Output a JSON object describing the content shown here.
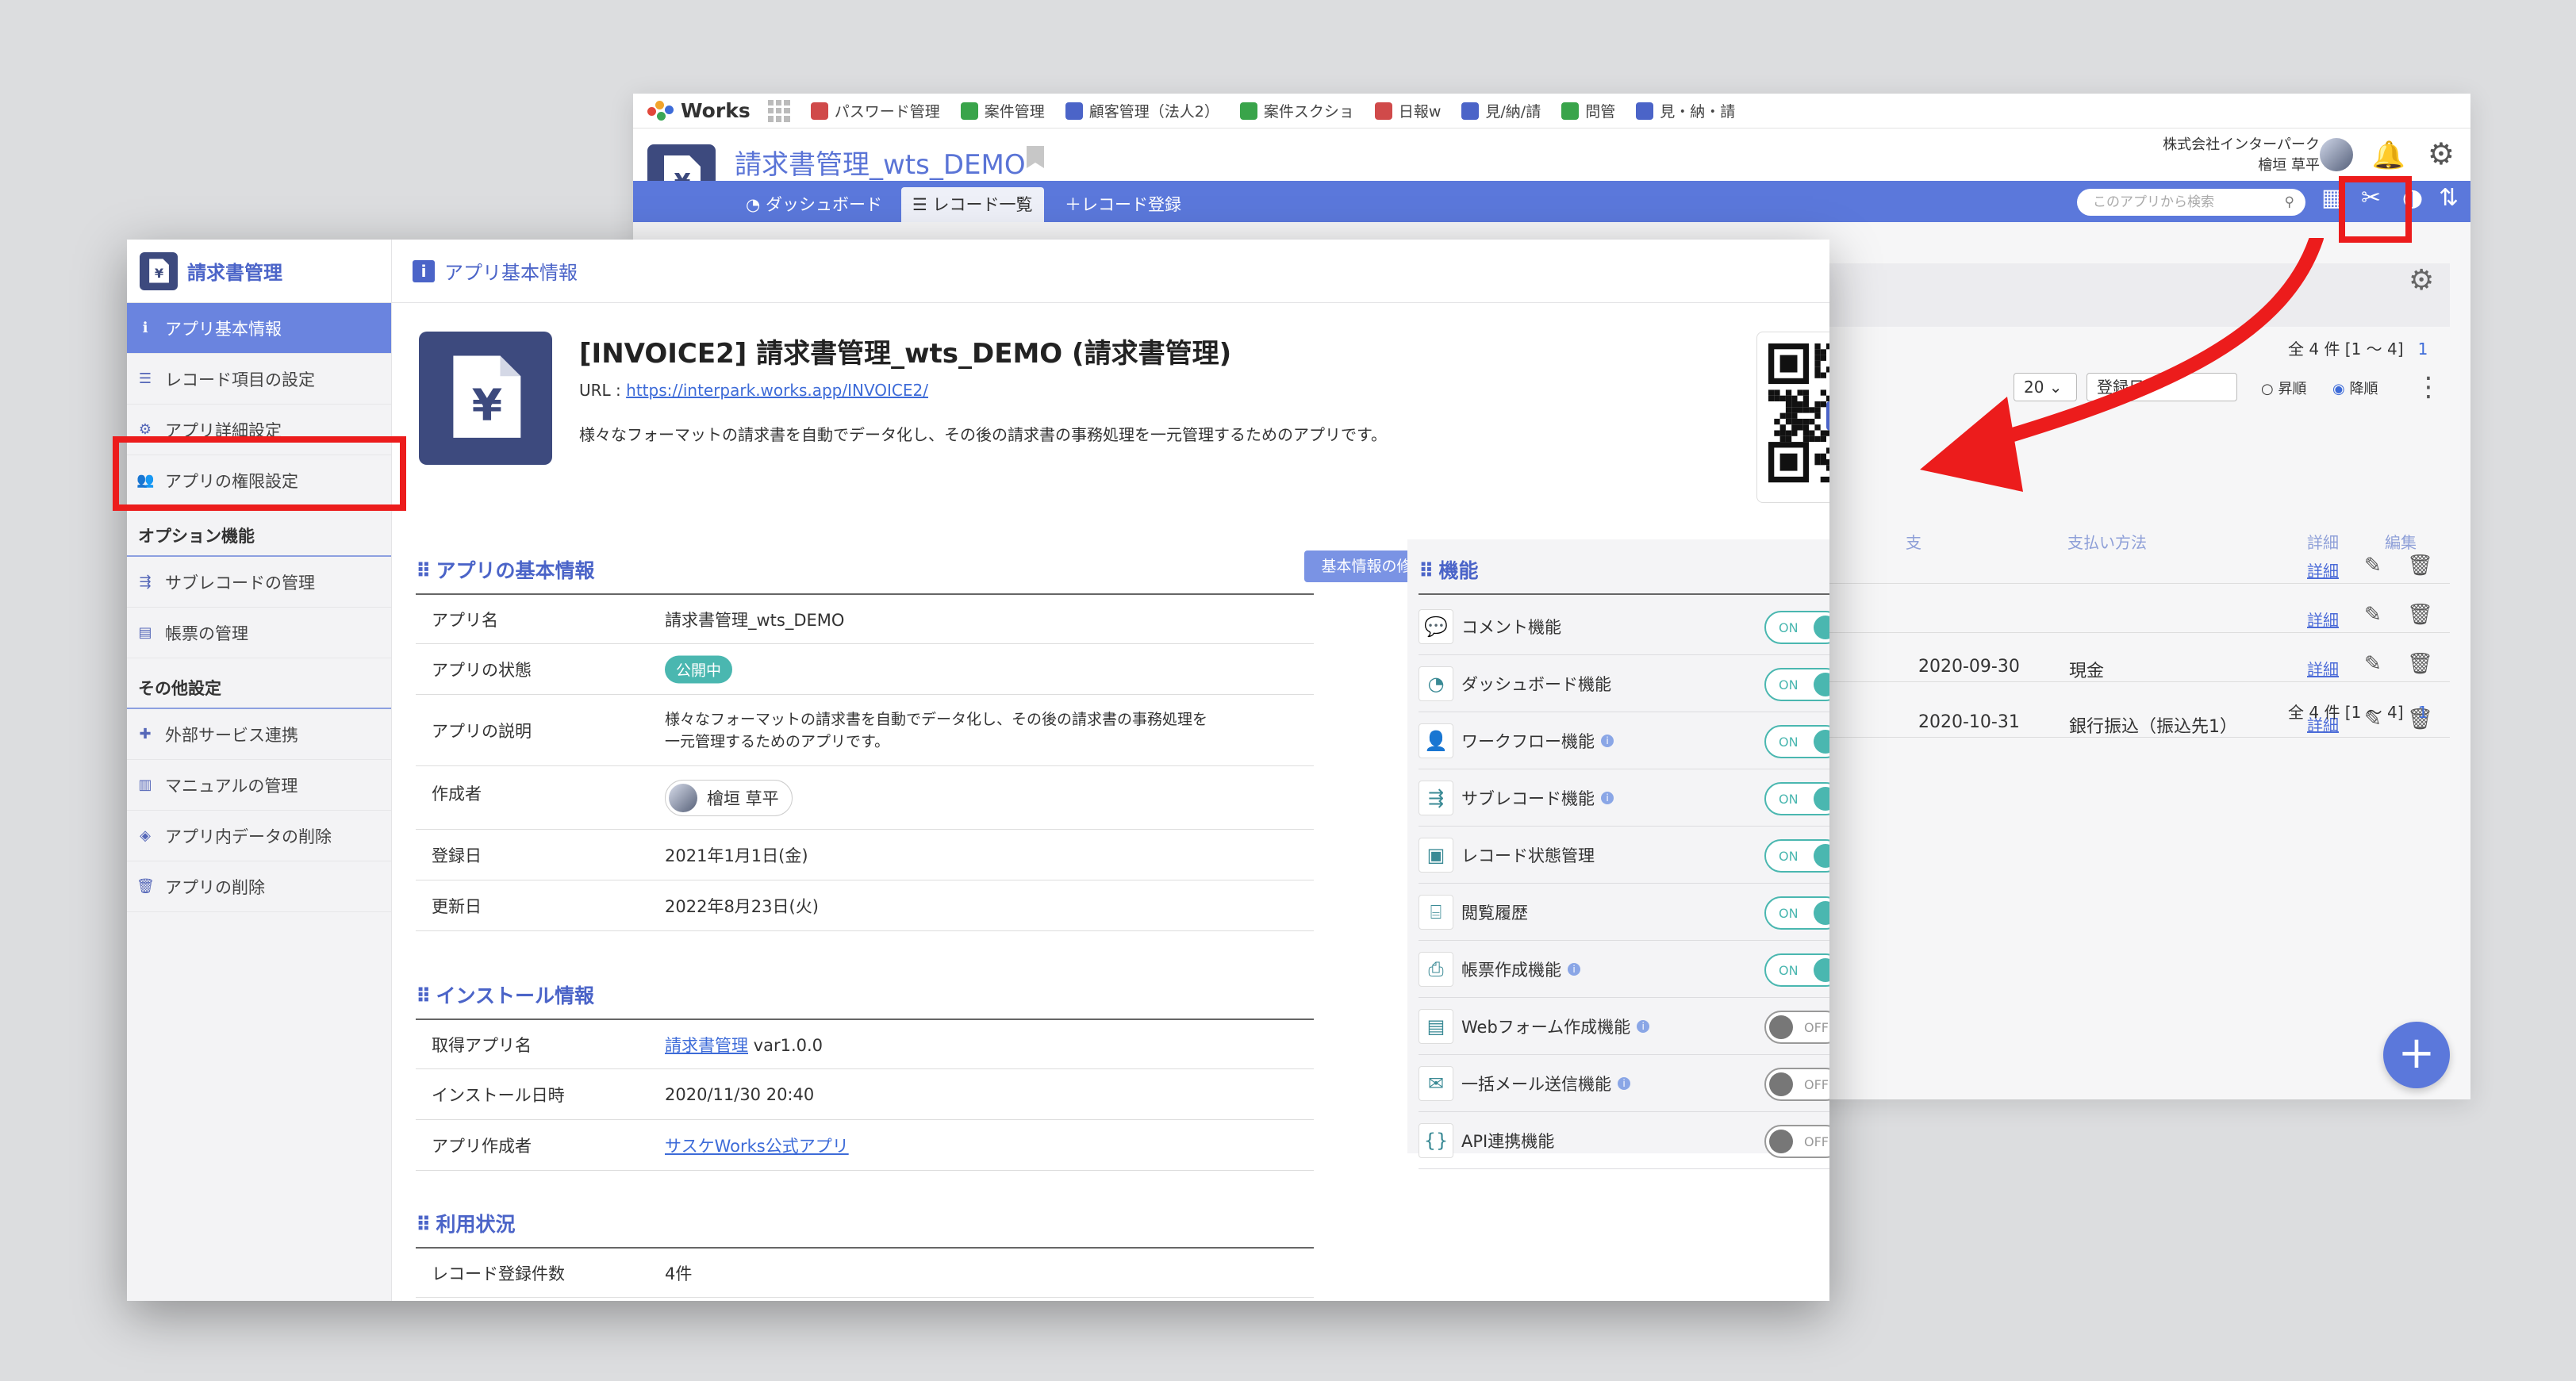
{
  "back": {
    "logo_text": "Works",
    "apps": [
      {
        "label": "パスワード管理",
        "color": "#d04a4a"
      },
      {
        "label": "案件管理",
        "color": "#39a44a"
      },
      {
        "label": "顧客管理（法人2）",
        "color": "#4b64c8"
      },
      {
        "label": "案件スクショ",
        "color": "#39a44a"
      },
      {
        "label": "日報w",
        "color": "#d04a4a"
      },
      {
        "label": "見/納/請",
        "color": "#4b64c8"
      },
      {
        "label": "問管",
        "color": "#39a44a"
      },
      {
        "label": "見・納・請",
        "color": "#4b64c8"
      }
    ],
    "app_title": "請求書管理_wts_DEMO",
    "company": "株式会社インターパーク",
    "user": "檜垣 草平",
    "tabs": [
      "ダッシュボード",
      "レコード一覧",
      "レコード登録"
    ],
    "search_placeholder": "このアプリから検索",
    "count_text": "全 4 件 [1 ～ 4]",
    "page_num": "1",
    "per_page": "20",
    "sort_field": "登録日",
    "sort_asc": "昇順",
    "sort_desc": "降順",
    "headers": [
      "支",
      "支払い方法",
      "詳細",
      "編集"
    ],
    "rows": [
      {
        "date": "",
        "method": "",
        "detail": "詳細"
      },
      {
        "date": "",
        "method": "",
        "detail": "詳細"
      },
      {
        "date": "2020-09-30",
        "method": "現金",
        "detail": "詳細"
      },
      {
        "date": "2020-10-31",
        "method": "銀行振込（振込先1）",
        "detail": "詳細"
      }
    ],
    "fab": "+"
  },
  "sidebar": {
    "title": "請求書管理",
    "items": [
      {
        "label": "アプリ基本情報",
        "icon": "info-icon"
      },
      {
        "label": "レコード項目の設定",
        "icon": "list-icon"
      },
      {
        "label": "アプリ詳細設定",
        "icon": "gear-icon"
      },
      {
        "label": "アプリの権限設定",
        "icon": "users-icon"
      }
    ],
    "option_section": "オプション機能",
    "option_items": [
      {
        "label": "サブレコードの管理",
        "icon": "subrecord-icon"
      },
      {
        "label": "帳票の管理",
        "icon": "document-icon"
      }
    ],
    "other_section": "その他設定",
    "other_items": [
      {
        "label": "外部サービス連携",
        "icon": "puzzle-icon"
      },
      {
        "label": "マニュアルの管理",
        "icon": "book-icon"
      },
      {
        "label": "アプリ内データの削除",
        "icon": "eraser-icon"
      },
      {
        "label": "アプリの削除",
        "icon": "trash-icon"
      }
    ]
  },
  "main": {
    "header": "アプリ基本情報",
    "app_heading": "[INVOICE2] 請求書管理_wts_DEMO (請求書管理)",
    "url_label": "URL : ",
    "url": "https://interpark.works.app/INVOICE2/",
    "description": "様々なフォーマットの請求書を自動でデータ化し、その後の請求書の事務処理を一元管理するためのアプリです。",
    "basic_section": "アプリの基本情報",
    "edit_button": "基本情報の修正",
    "basic_rows": {
      "name_k": "アプリ名",
      "name_v": "請求書管理_wts_DEMO",
      "state_k": "アプリの状態",
      "state_v": "公開中",
      "desc_k": "アプリの説明",
      "desc_v1": "様々なフォーマットの請求書を自動でデータ化し、その後の請求書の事務処理を",
      "desc_v2": "一元管理するためのアプリです。",
      "creator_k": "作成者",
      "creator_v": "檜垣 草平",
      "reg_k": "登録日",
      "reg_v": "2021年1月1日(金)",
      "upd_k": "更新日",
      "upd_v": "2022年8月23日(火)"
    },
    "install_section": "インストール情報",
    "install_rows": {
      "src_k": "取得アプリ名",
      "src_link": "請求書管理",
      "src_ver": " var1.0.0",
      "dt_k": "インストール日時",
      "dt_v": "2020/11/30 20:40",
      "author_k": "アプリ作成者",
      "author_v": "サスケWorks公式アプリ"
    },
    "usage_section": "利用状況",
    "usage_rows": {
      "count_k": "レコード登録件数",
      "count_v": "4件"
    },
    "features_section": "機能",
    "features": [
      {
        "label": "コメント機能",
        "on": true,
        "info": false
      },
      {
        "label": "ダッシュボード機能",
        "on": true,
        "info": false
      },
      {
        "label": "ワークフロー機能",
        "on": true,
        "info": true
      },
      {
        "label": "サブレコード機能",
        "on": true,
        "info": true
      },
      {
        "label": "レコード状態管理",
        "on": true,
        "info": false
      },
      {
        "label": "閲覧履歴",
        "on": true,
        "info": false
      },
      {
        "label": "帳票作成機能",
        "on": true,
        "info": true
      },
      {
        "label": "Webフォーム作成機能",
        "on": false,
        "info": true
      },
      {
        "label": "一括メール送信機能",
        "on": false,
        "info": true
      },
      {
        "label": "API連携機能",
        "on": false,
        "info": false
      }
    ],
    "on_text": "ON",
    "off_text": "OFF"
  },
  "colors": {
    "accent": "#5b78db",
    "highlight": "#ec1c1c",
    "toggle_on": "#4ab7b0",
    "tile": "#3d4a7e"
  }
}
